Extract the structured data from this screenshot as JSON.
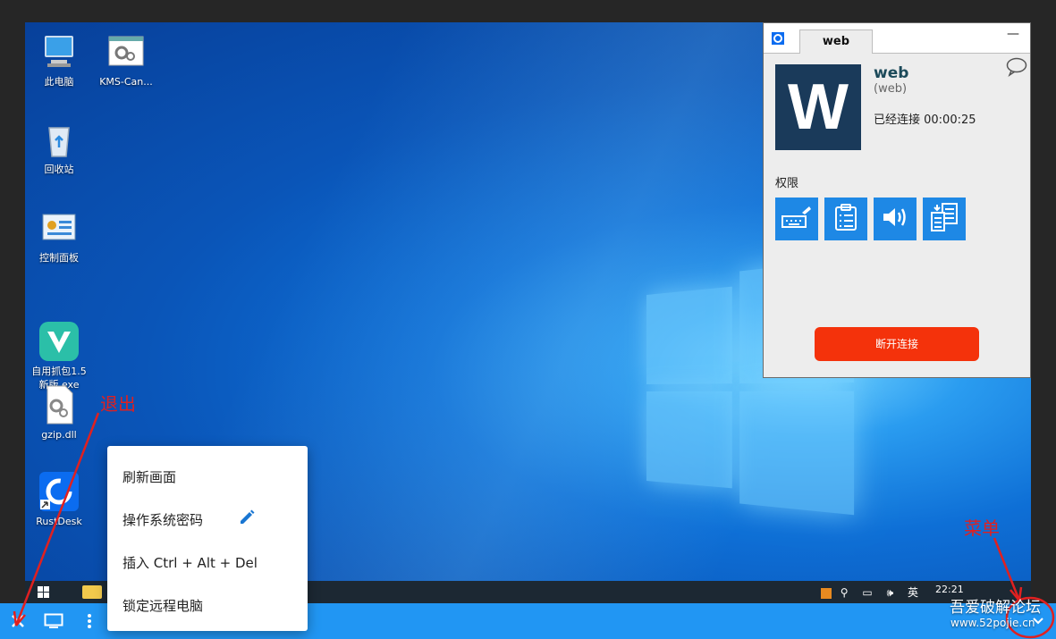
{
  "desktop_icons": [
    {
      "label": "此电脑",
      "icon": "computer-icon"
    },
    {
      "label": "KMS-Can...",
      "icon": "settings-file-icon"
    },
    {
      "label": "回收站",
      "icon": "recycle-bin-icon"
    },
    {
      "label": "控制面板",
      "icon": "control-panel-icon"
    },
    {
      "label": "自用抓包1.5\n新版.exe",
      "icon": "app-v-icon"
    },
    {
      "label": "gzip.dll",
      "icon": "dll-file-icon"
    },
    {
      "label": "RustDesk",
      "icon": "rustdesk-icon"
    }
  ],
  "taskbar": {
    "tray": "英",
    "clock": "22:21"
  },
  "context_menu": {
    "items": [
      "刷新画面",
      "操作系统密码",
      "插入 Ctrl + Alt + Del",
      "锁定远程电脑"
    ]
  },
  "connection_manager": {
    "tab": "web",
    "name": "web",
    "id": "(web)",
    "avatar_letter": "W",
    "status": "已经连接 00:00:25",
    "permissions_label": "权限",
    "permissions": [
      "keyboard-icon",
      "clipboard-icon",
      "audio-icon",
      "file-transfer-icon"
    ],
    "disconnect_label": "断开连接",
    "colors": {
      "perm": "#1e88e5",
      "disconnect": "#f4320b",
      "avatar": "#1a3a5a"
    }
  },
  "bottom_bar": {
    "color": "#2196f3"
  },
  "annotations": {
    "exit": "退出",
    "menu": "菜单"
  },
  "watermark": {
    "line1": "吾爱破解论坛",
    "line2": "www.52pojie.cn"
  }
}
